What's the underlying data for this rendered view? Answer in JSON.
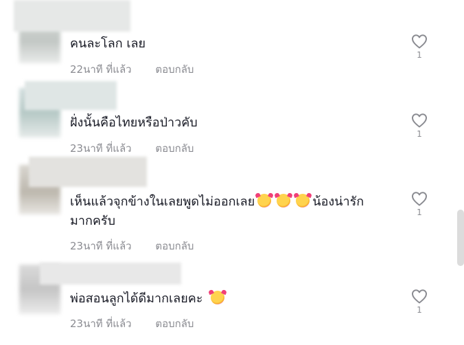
{
  "comments": [
    {
      "text": "คนละโลก เลย",
      "time": "22นาที ที่แล้ว",
      "reply": "ตอบกลับ",
      "likes": "1"
    },
    {
      "text": "ฝั่งนั้นคือไทยหรือป่าวคับ",
      "time": "23นาที ที่แล้ว",
      "reply": "ตอบกลับ",
      "likes": "1"
    },
    {
      "text_before": "เห็นแล้วจุกข้างในเลยพูดไม่ออกเลย",
      "text_after": "น้องน่ารัก",
      "text_line2": "มากครับ",
      "emoji": "smiling-face-with-hearts",
      "time": "23นาที ที่แล้ว",
      "reply": "ตอบกลับ",
      "likes": "1"
    },
    {
      "text": "พ่อสอนลูกได้ดีมากเลยคะ",
      "emoji": "smiling-face-with-hearts",
      "time": "23นาที ที่แล้ว",
      "reply": "ตอบกลับ",
      "likes": "1"
    }
  ],
  "colors": {
    "text": "#161823",
    "meta": "#8a8b91",
    "heart_stroke": "#8a8b91"
  }
}
